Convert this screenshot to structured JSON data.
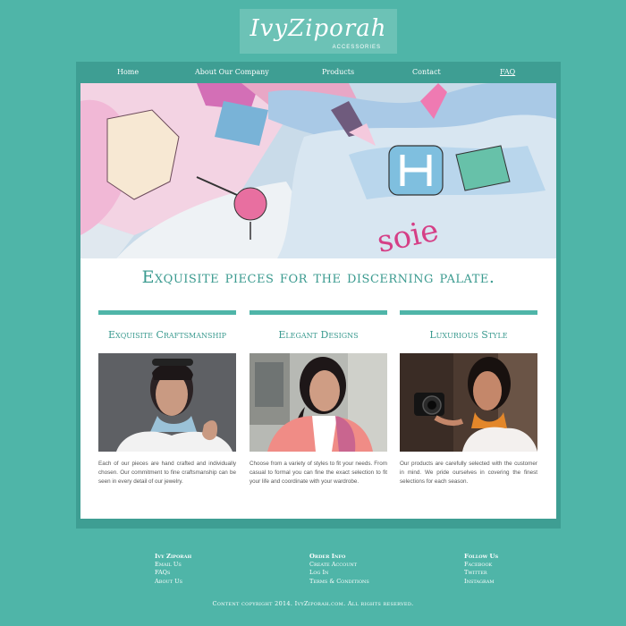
{
  "brand": {
    "name": "IvyZiporah",
    "tagline": "ACCESSORIES"
  },
  "nav": {
    "items": [
      {
        "label": "Home"
      },
      {
        "label": "About Our Company"
      },
      {
        "label": "Products"
      },
      {
        "label": "Contact"
      },
      {
        "label": "FAQ"
      }
    ]
  },
  "hero": {
    "scarf_text": "soie"
  },
  "headline": "Exquisite pieces for the discerning palate.",
  "columns": [
    {
      "title": "Exquisite Craftsmanship",
      "text": "Each of our pieces are hand crafted and individually chosen. Our commitment to fine craftsmanship can be seen in every detail of our jewelry."
    },
    {
      "title": "Elegant Designs",
      "text": "Choose from a variety of styles to fit your needs. From casual to formal you can fine the exact selection to fit your life and coordinate with your wardrobe."
    },
    {
      "title": "Luxurious Style",
      "text": "Our products are carefully selected with the customer in mind. We pride ourselves in covering the finest selections for each season."
    }
  ],
  "footer": {
    "col1": {
      "heading": "Ivy Ziporah",
      "links": [
        "Email Us",
        "FAQs",
        "About Us"
      ]
    },
    "col2": {
      "heading": "Order Info",
      "links": [
        "Create Account",
        "Log In",
        "Terms & Conditions"
      ]
    },
    "col3": {
      "heading": "Follow Us",
      "links": [
        "Facebook",
        "Twitter",
        "Instagram"
      ]
    },
    "copyright": "Content copyright 2014. IvyZiporah.com. All rights reserved."
  },
  "colors": {
    "background": "#4fb5a8",
    "nav": "#3e9e93",
    "accent": "#3a9a8f",
    "content": "#ffffff"
  }
}
